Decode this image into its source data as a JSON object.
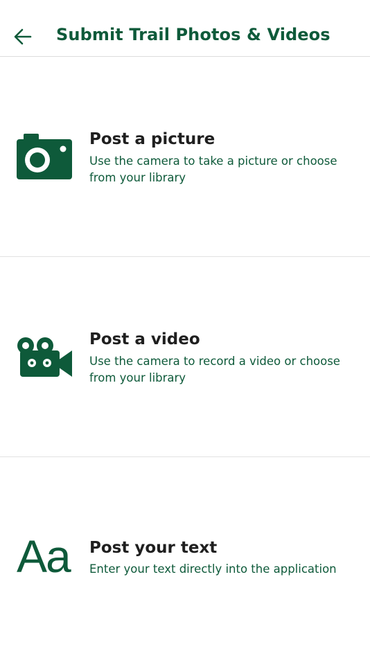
{
  "header": {
    "title": "Submit Trail Photos & Videos",
    "back_icon": "arrow-left-icon"
  },
  "colors": {
    "accent": "#0e5a3a",
    "title_text": "#1f1f1f",
    "divider": "#e2e2e2"
  },
  "options": [
    {
      "icon": "camera-icon",
      "title": "Post a picture",
      "description": "Use the camera to take a picture or choose from your library"
    },
    {
      "icon": "video-camera-icon",
      "title": "Post a video",
      "description": "Use the camera to record a video or choose from your library"
    },
    {
      "icon": "text-icon",
      "icon_text": "Aa",
      "title": "Post your text",
      "description": "Enter your text directly into the application"
    }
  ]
}
